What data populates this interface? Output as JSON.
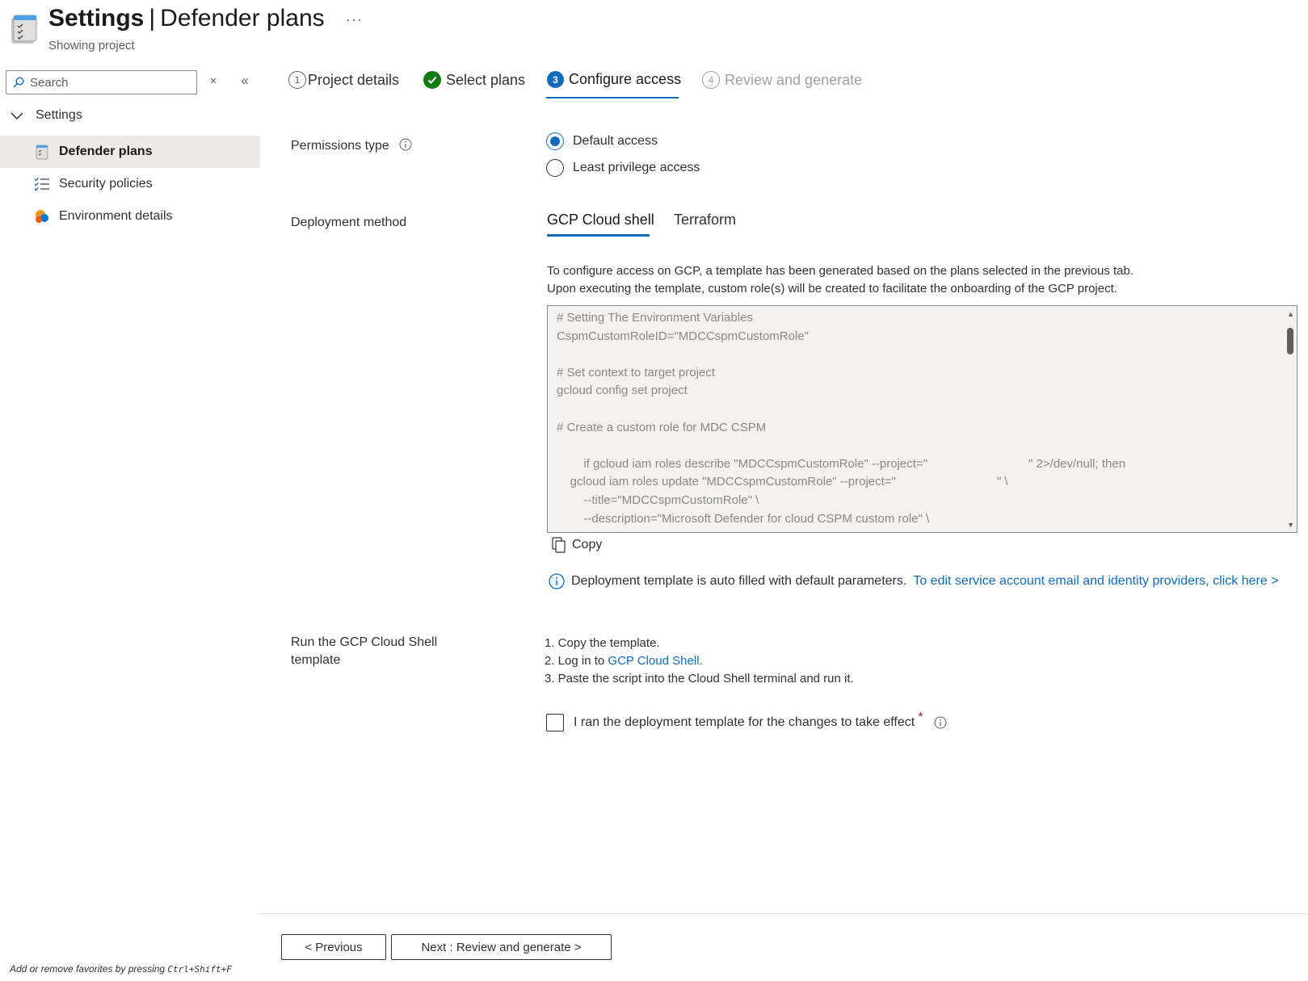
{
  "header": {
    "title_bold": "Settings",
    "separator": "|",
    "title_rest": "Defender plans",
    "more": "···",
    "subtitle": "Showing project"
  },
  "sidebar": {
    "search_placeholder": "Search",
    "clear_icon": "×",
    "collapse_icon": "«",
    "group_label": "Settings",
    "items": [
      {
        "label": "Defender plans",
        "icon": "defender-plans-icon",
        "active": true
      },
      {
        "label": "Security policies",
        "icon": "policy-list-icon",
        "active": false
      },
      {
        "label": "Environment details",
        "icon": "cloud-environment-icon",
        "active": false
      }
    ],
    "favorites_tip_prefix": "Add or remove favorites by pressing ",
    "favorites_tip_keys": "Ctrl+Shift+F"
  },
  "wizard": {
    "steps": [
      {
        "num": "1",
        "label": "Project details",
        "state": "visited"
      },
      {
        "num": "✓",
        "label": "Select plans",
        "state": "done"
      },
      {
        "num": "3",
        "label": "Configure access",
        "state": "current"
      },
      {
        "num": "4",
        "label": "Review and generate",
        "state": "disabled"
      }
    ]
  },
  "form": {
    "permissions_label": "Permissions type",
    "permissions_options": [
      {
        "label": "Default access",
        "selected": true
      },
      {
        "label": "Least privilege access",
        "selected": false
      }
    ],
    "deployment_label": "Deployment method",
    "deployment_tabs": [
      {
        "label": "GCP Cloud shell",
        "selected": true
      },
      {
        "label": "Terraform",
        "selected": false
      }
    ],
    "description_line1": "To configure access on GCP, a template has been generated based on the plans selected in the previous tab.",
    "description_line2": "Upon executing the template, custom role(s) will be created to facilitate the onboarding of the GCP project.",
    "code": "# Setting The Environment Variables\nCspmCustomRoleID=\"MDCCspmCustomRole\"\n\n# Set context to target project\ngcloud config set project\n\n# Create a custom role for MDC CSPM\n\n        if gcloud iam roles describe \"MDCCspmCustomRole\" --project=\"                              \" 2>/dev/null; then\n    gcloud iam roles update \"MDCCspmCustomRole\" --project=\"                              \" \\\n        --title=\"MDCCspmCustomRole\" \\\n        --description=\"Microsoft Defender for cloud CSPM custom role\" \\",
    "copy_label": "Copy",
    "note_text": "Deployment template is auto filled with default parameters.",
    "note_link": "To edit service account email and identity providers, click here >",
    "run_label_line1": "Run the GCP Cloud Shell",
    "run_label_line2": "template",
    "steps": {
      "s1": "1. Copy the template.",
      "s2_prefix": "2. Log in to ",
      "s2_link": "GCP Cloud Shell.",
      "s3": "3. Paste the script into the Cloud Shell terminal and run it."
    },
    "confirm_label": "I ran the deployment template for the changes to take effect",
    "confirm_required": "*",
    "confirm_checked": false
  },
  "footer": {
    "previous": "< Previous",
    "next": "Next : Review and generate >"
  },
  "colors": {
    "accent": "#0f6cbd",
    "success": "#107c10",
    "required": "#a4262c"
  }
}
